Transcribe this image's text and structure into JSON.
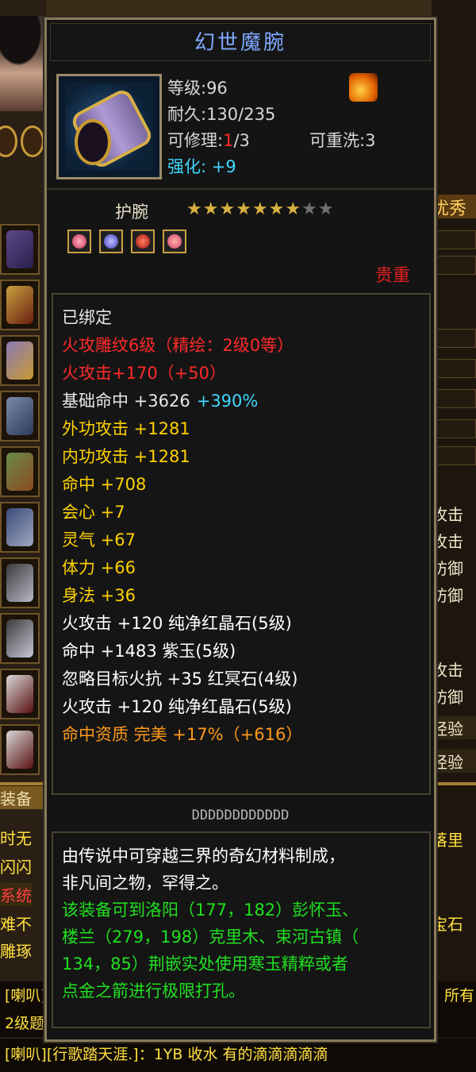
{
  "item": {
    "name": "幻世魔腕",
    "level": "等级:96",
    "durability": "耐久:130/235",
    "repair_prefix": "可修理:",
    "repair_used": "1",
    "repair_total": "/3",
    "rewash": "可重洗:3",
    "enhance_label": "强化:",
    "enhance_value": "+9",
    "type": "护腕",
    "stars_filled": 7,
    "stars_total": 9,
    "rarity": "贵重",
    "gems": [
      "pink-gem",
      "blue-gem",
      "red-gem",
      "pink-gem"
    ]
  },
  "attributes": [
    {
      "text": "已绑定",
      "color": "#e8e8e8"
    },
    {
      "text": "火攻雕纹6级（精绘：2级0等）",
      "color": "#ff2a2a"
    },
    {
      "text": "火攻击+170（+50）",
      "color": "#ff2a2a"
    },
    {
      "text": "基础命中 +3626",
      "color": "#e8e8e8",
      "extra": "+390%",
      "extra_color": "#40d8ff"
    },
    {
      "text": "外功攻击 +1281",
      "color": "#ffd200"
    },
    {
      "text": "内功攻击 +1281",
      "color": "#ffd200"
    },
    {
      "text": "命中 +708",
      "color": "#ffd200"
    },
    {
      "text": "会心 +7",
      "color": "#ffd200"
    },
    {
      "text": "灵气 +67",
      "color": "#ffd200"
    },
    {
      "text": "体力 +66",
      "color": "#ffd200"
    },
    {
      "text": "身法 +36",
      "color": "#ffd200"
    },
    {
      "text": "火攻击 +120 纯净红晶石(5级)",
      "color": "#ffffff"
    },
    {
      "text": "命中 +1483 紫玉(5级)",
      "color": "#ffffff"
    },
    {
      "text": "忽略目标火抗 +35 红冥石(4级)",
      "color": "#ffffff"
    },
    {
      "text": "火攻击 +120 纯净红晶石(5级)",
      "color": "#ffffff"
    },
    {
      "text": "命中资质  完美 +17%（+616）",
      "color": "#ff9a1a"
    }
  ],
  "serial": "DDDDDDDDDDDD",
  "description": [
    {
      "text": "由传说中可穿越三界的奇幻材料制成，",
      "color": "#ffffff"
    },
    {
      "text": "非凡间之物，罕得之。",
      "color": "#ffffff"
    },
    {
      "text": "该装备可到洛阳（177，182）彭怀玉、",
      "color": "#20e020"
    },
    {
      "text": "楼兰（279，198）克里木、束河古镇（",
      "color": "#20e020"
    },
    {
      "text": "134，85）荆嵌实处使用寒玉精粹或者",
      "color": "#20e020"
    },
    {
      "text": "点金之箭进行极限打孔。",
      "color": "#20e020"
    }
  ],
  "background": {
    "left_labels": [
      "装备",
      "时无",
      "闪闪",
      "系统",
      "难不",
      "雕琢"
    ],
    "right_labels": [
      "优秀",
      "攻击",
      "攻击",
      "防御",
      "防御",
      "攻击",
      "防御",
      "经验",
      "经验",
      "落里",
      "宝石"
    ],
    "chat": [
      {
        "text": "[喇叭]",
        "color": "#ffe040"
      },
      {
        "text": "2级题",
        "color": "#ffe040"
      },
      {
        "text": "[喇叭][行歌踏天涯.]：1YB 收水  有的滴滴滴滴滴",
        "color": "#ffe040"
      },
      {
        "text": "所有",
        "color": "#ffe040"
      }
    ]
  },
  "colors": {
    "title": "#7fa8ff",
    "enhance": "#40d8ff",
    "repair_used": "#ff2a2a",
    "rarity": "#e02020",
    "panel_border": "#8a7a5a"
  }
}
